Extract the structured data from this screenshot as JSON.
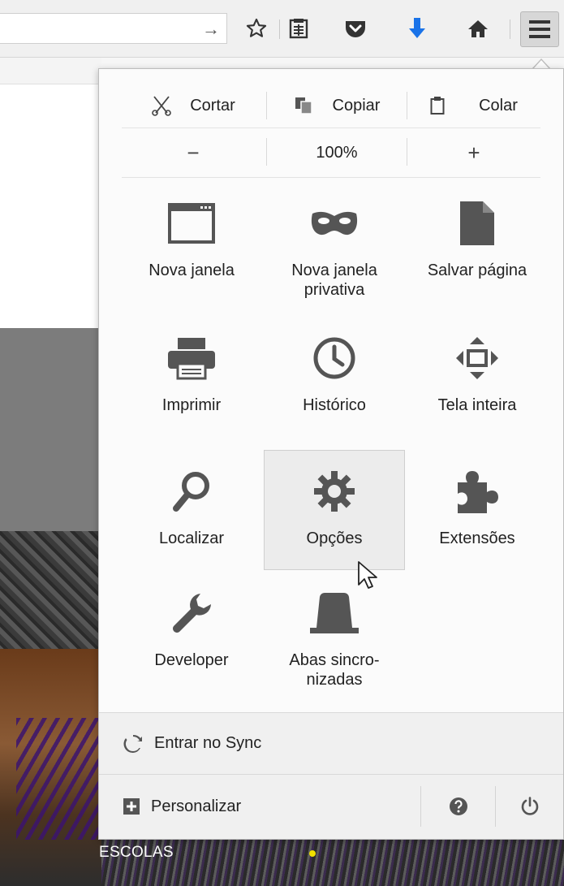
{
  "toolbar": {
    "icons": [
      "go-arrow-icon",
      "bookmark-star-icon",
      "reading-list-icon",
      "pocket-icon",
      "downloads-icon",
      "home-icon",
      "hamburger-menu-icon"
    ],
    "accent_download": "#1a73e8"
  },
  "menu": {
    "edit": {
      "cut": "Cortar",
      "copy": "Copiar",
      "paste": "Colar"
    },
    "zoom": {
      "minus": "−",
      "level": "100%",
      "plus": "+"
    },
    "items": [
      {
        "label": "Nova janela",
        "icon": "window-icon"
      },
      {
        "label": "Nova janela privativa",
        "icon": "private-mask-icon"
      },
      {
        "label": "Salvar página",
        "icon": "save-page-icon"
      },
      {
        "label": "Imprimir",
        "icon": "printer-icon"
      },
      {
        "label": "Histórico",
        "icon": "history-clock-icon"
      },
      {
        "label": "Tela inteira",
        "icon": "fullscreen-icon"
      },
      {
        "label": "Localizar",
        "icon": "search-icon"
      },
      {
        "label": "Opções",
        "icon": "gear-icon"
      },
      {
        "label": "Extensões",
        "icon": "puzzle-icon"
      },
      {
        "label": "Developer",
        "icon": "wrench-icon"
      },
      {
        "label": "Abas sincro-nizadas",
        "icon": "synced-tabs-icon"
      }
    ],
    "sync_label": "Entrar no Sync",
    "customize_label": "Personalizar"
  },
  "page": {
    "caption": "ESCOLAS"
  }
}
